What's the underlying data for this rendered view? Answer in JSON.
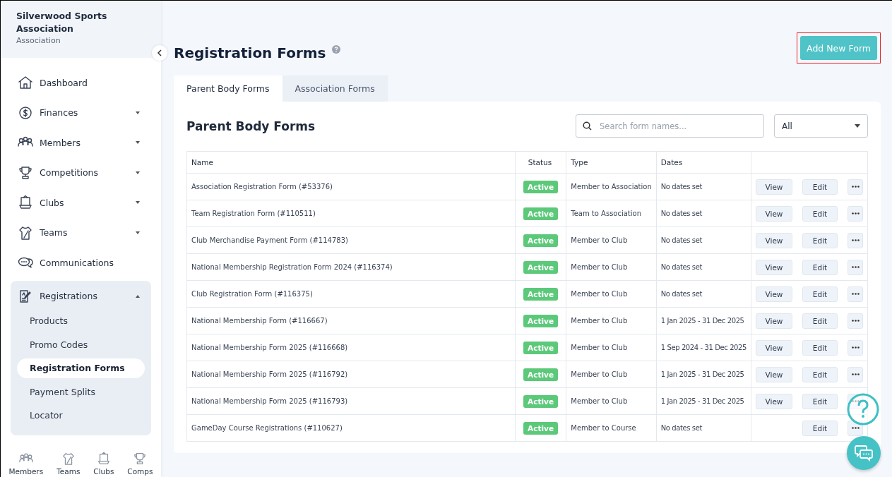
{
  "sidebar": {
    "org_name": "Silverwood Sports Association",
    "org_type": "Association",
    "items": [
      {
        "label": "Dashboard"
      },
      {
        "label": "Finances",
        "expanded": false
      },
      {
        "label": "Members",
        "expanded": false
      },
      {
        "label": "Competitions",
        "expanded": false
      },
      {
        "label": "Clubs",
        "expanded": false
      },
      {
        "label": "Teams",
        "expanded": false
      },
      {
        "label": "Communications"
      },
      {
        "label": "Registrations",
        "expanded": true,
        "children": [
          {
            "label": "Products",
            "selected": false
          },
          {
            "label": "Promo Codes",
            "selected": false
          },
          {
            "label": "Registration Forms",
            "selected": true
          },
          {
            "label": "Payment Splits",
            "selected": false
          },
          {
            "label": "Locator",
            "selected": false
          }
        ]
      }
    ],
    "bottom_nav": [
      {
        "label": "Members"
      },
      {
        "label": "Teams"
      },
      {
        "label": "Clubs"
      },
      {
        "label": "Comps"
      }
    ]
  },
  "page": {
    "title": "Registration Forms",
    "add_button": {
      "label": "Add New Form",
      "highlighted": true
    }
  },
  "tabs": [
    {
      "label": "Parent Body Forms",
      "selected": true
    },
    {
      "label": "Association Forms",
      "selected": false
    }
  ],
  "panel": {
    "title": "Parent Body Forms",
    "search": {
      "placeholder": "Search form names..."
    },
    "filter": {
      "value": "All"
    }
  },
  "table": {
    "columns": [
      "Name",
      "Status",
      "Type",
      "Dates"
    ],
    "rows": [
      {
        "name": "Association Registration Form (#53376)",
        "status": "Active",
        "type": "Member to Association",
        "dates": "No dates set",
        "buttons": [
          "View",
          "Edit"
        ]
      },
      {
        "name": "Team Registration Form (#110511)",
        "status": "Active",
        "type": "Team to Association",
        "dates": "No dates set",
        "buttons": [
          "View",
          "Edit"
        ]
      },
      {
        "name": "Club Merchandise Payment Form (#114783)",
        "status": "Active",
        "type": "Member to Club",
        "dates": "No dates set",
        "buttons": [
          "View",
          "Edit"
        ]
      },
      {
        "name": "National Membership Registration Form 2024 (#116374)",
        "status": "Active",
        "type": "Member to Club",
        "dates": "No dates set",
        "buttons": [
          "View",
          "Edit"
        ]
      },
      {
        "name": "Club Registration Form (#116375)",
        "status": "Active",
        "type": "Member to Club",
        "dates": "No dates set",
        "buttons": [
          "View",
          "Edit"
        ]
      },
      {
        "name": "National Membership Form (#116667)",
        "status": "Active",
        "type": "Member to Club",
        "dates": "1 Jan 2025 - 31 Dec 2025",
        "buttons": [
          "View",
          "Edit"
        ]
      },
      {
        "name": "National Membership Form 2025 (#116668)",
        "status": "Active",
        "type": "Member to Club",
        "dates": "1 Sep 2024 - 31 Dec 2025",
        "buttons": [
          "View",
          "Edit"
        ]
      },
      {
        "name": "National Membership Form 2025 (#116792)",
        "status": "Active",
        "type": "Member to Club",
        "dates": "1 Jan 2025 - 31 Dec 2025",
        "buttons": [
          "View",
          "Edit"
        ]
      },
      {
        "name": "National Membership Form 2025 (#116793)",
        "status": "Active",
        "type": "Member to Club",
        "dates": "1 Jan 2025 - 31 Dec 2025",
        "buttons": [
          "View",
          "Edit"
        ]
      },
      {
        "name": "GameDay Course Registrations (#110627)",
        "status": "Active",
        "type": "Member to Course",
        "dates": "No dates set",
        "buttons": [
          "Edit"
        ]
      }
    ]
  }
}
